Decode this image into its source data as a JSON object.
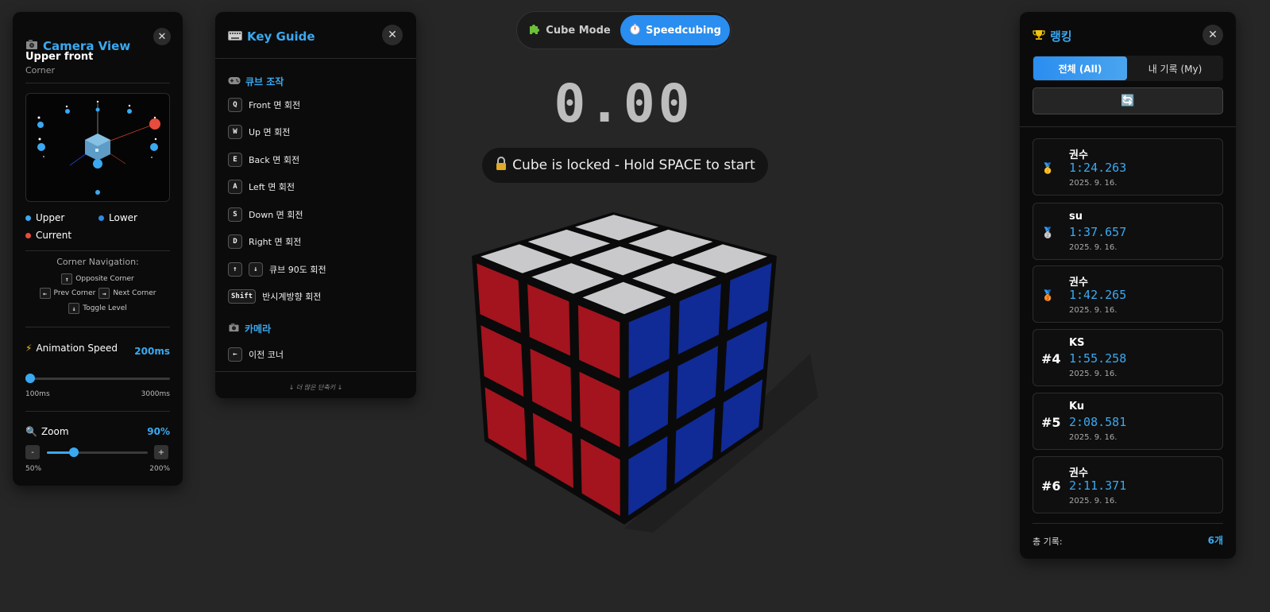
{
  "camera_panel": {
    "icon": "camera-icon",
    "title": "Camera View",
    "close": "✕",
    "camera_name": "Upper front",
    "camera_type": "Corner",
    "legend": {
      "upper": "Upper",
      "lower": "Lower",
      "current": "Current"
    },
    "nav_title": "Corner Navigation:",
    "nav": {
      "opposite_key": "↑",
      "opposite": "Opposite Corner",
      "prev_key": "←",
      "prev": "Prev Corner",
      "next_key": "→",
      "next": "Next Corner",
      "toggle_key": "↓",
      "toggle": "Toggle Level"
    },
    "animation": {
      "icon": "⚡",
      "label": "Animation Speed",
      "value": "200ms",
      "min": "100ms",
      "max": "3000ms",
      "level": 0.034
    },
    "zoom": {
      "icon": "🔍",
      "label": "Zoom",
      "value": "90%",
      "min": "50%",
      "max": "200%",
      "minus": "-",
      "plus": "+",
      "level": 0.27
    }
  },
  "key_guide": {
    "icon": "keyboard-icon",
    "title": "Key Guide",
    "close": "✕",
    "section_cube": "큐브 조작",
    "keys": [
      {
        "key": "Q",
        "label": "Front 면 회전"
      },
      {
        "key": "W",
        "label": "Up 면 회전"
      },
      {
        "key": "E",
        "label": "Back 면 회전"
      },
      {
        "key": "A",
        "label": "Left 면 회전"
      },
      {
        "key": "S",
        "label": "Down 면 회전"
      },
      {
        "key": "D",
        "label": "Right 면 회전"
      }
    ],
    "arrow_keys": {
      "up": "↑",
      "down": "↓",
      "label": "큐브 90도 회전"
    },
    "shift": {
      "key": "Shift",
      "label": "반시계방향 회전"
    },
    "section_camera": "카메라",
    "camera_keys": [
      {
        "key": "←",
        "label": "이전 코너"
      }
    ],
    "more": "↓ 더 많은 단축키 ↓"
  },
  "mode_toggle": {
    "cube_mode": "Cube Mode",
    "speedcubing": "Speedcubing"
  },
  "timer": "0.00",
  "lock_message": "Cube is locked - Hold SPACE to start",
  "cube_colors": {
    "top": "#c9c9cc",
    "left": "#a3141e",
    "right": "#102a96"
  },
  "ranking": {
    "icon": "trophy-icon",
    "title": "랭킹",
    "close": "✕",
    "tab_all": "전체 (All)",
    "tab_my": "내 기록 (My)",
    "refresh_icon": "🔄",
    "entries": [
      {
        "rank": "🥇",
        "name": "권수",
        "time": "1:24.263",
        "date": "2025. 9. 16."
      },
      {
        "rank": "🥈",
        "name": "su",
        "time": "1:37.657",
        "date": "2025. 9. 16."
      },
      {
        "rank": "🥉",
        "name": "권수",
        "time": "1:42.265",
        "date": "2025. 9. 16."
      },
      {
        "rank": "#4",
        "name": "KS",
        "time": "1:55.258",
        "date": "2025. 9. 16."
      },
      {
        "rank": "#5",
        "name": "Ku",
        "time": "2:08.581",
        "date": "2025. 9. 16."
      },
      {
        "rank": "#6",
        "name": "권수",
        "time": "2:11.371",
        "date": "2025. 9. 16."
      }
    ],
    "total_label": "총 기록:",
    "total_value": "6개"
  }
}
